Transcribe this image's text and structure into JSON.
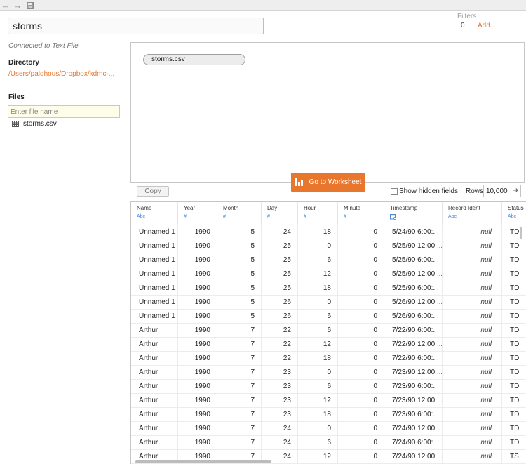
{
  "toolbar": {
    "back_icon": "back-arrow-icon",
    "forward_icon": "forward-arrow-icon",
    "save_icon": "save-icon"
  },
  "datasource": {
    "name": "storms"
  },
  "filters": {
    "title": "Filters",
    "count": "0",
    "add_label": "Add..."
  },
  "connection": {
    "status": "Connected to Text File",
    "directory_title": "Directory",
    "directory_path": "/Users/paldhous/Dropbox/kdmc-...",
    "files_title": "Files",
    "file_search_placeholder": "Enter file name",
    "files": [
      {
        "name": "storms.csv",
        "icon": "table-icon"
      }
    ]
  },
  "canvas": {
    "table_pill": "storms.csv"
  },
  "go_to_worksheet": {
    "label": "Go to Worksheet",
    "icon": "bar-chart-icon"
  },
  "grid_controls": {
    "copy_label": "Copy",
    "show_hidden_label": "Show hidden fields",
    "show_hidden_checked": false,
    "rows_label": "Rows",
    "rows_value": "10,000",
    "rows_arrow_icon": "arrow-right-icon"
  },
  "colors": {
    "accent": "#e8762c",
    "type_icon": "#4a8ad6"
  },
  "columns": [
    {
      "name": "Name",
      "type": "Abc",
      "type_icon": "string-type-icon"
    },
    {
      "name": "Year",
      "type": "#",
      "type_icon": "number-type-icon"
    },
    {
      "name": "Month",
      "type": "#",
      "type_icon": "number-type-icon"
    },
    {
      "name": "Day",
      "type": "#",
      "type_icon": "number-type-icon"
    },
    {
      "name": "Hour",
      "type": "#",
      "type_icon": "number-type-icon"
    },
    {
      "name": "Minute",
      "type": "#",
      "type_icon": "number-type-icon"
    },
    {
      "name": "Timestamp",
      "type": "",
      "type_icon": "date-time-type-icon"
    },
    {
      "name": "Record Ident",
      "type": "Abc",
      "type_icon": "string-type-icon"
    },
    {
      "name": "Status",
      "type": "Abc",
      "type_icon": "string-type-icon"
    }
  ],
  "rows": [
    [
      "Unnamed 1",
      "1990",
      "5",
      "24",
      "18",
      "0",
      "5/24/90 6:00:...",
      "null",
      "TD"
    ],
    [
      "Unnamed 1",
      "1990",
      "5",
      "25",
      "0",
      "0",
      "5/25/90 12:00:...",
      "null",
      "TD"
    ],
    [
      "Unnamed 1",
      "1990",
      "5",
      "25",
      "6",
      "0",
      "5/25/90 6:00:...",
      "null",
      "TD"
    ],
    [
      "Unnamed 1",
      "1990",
      "5",
      "25",
      "12",
      "0",
      "5/25/90 12:00:...",
      "null",
      "TD"
    ],
    [
      "Unnamed 1",
      "1990",
      "5",
      "25",
      "18",
      "0",
      "5/25/90 6:00:...",
      "null",
      "TD"
    ],
    [
      "Unnamed 1",
      "1990",
      "5",
      "26",
      "0",
      "0",
      "5/26/90 12:00:...",
      "null",
      "TD"
    ],
    [
      "Unnamed 1",
      "1990",
      "5",
      "26",
      "6",
      "0",
      "5/26/90 6:00:...",
      "null",
      "TD"
    ],
    [
      "Arthur",
      "1990",
      "7",
      "22",
      "6",
      "0",
      "7/22/90 6:00:...",
      "null",
      "TD"
    ],
    [
      "Arthur",
      "1990",
      "7",
      "22",
      "12",
      "0",
      "7/22/90 12:00:...",
      "null",
      "TD"
    ],
    [
      "Arthur",
      "1990",
      "7",
      "22",
      "18",
      "0",
      "7/22/90 6:00:...",
      "null",
      "TD"
    ],
    [
      "Arthur",
      "1990",
      "7",
      "23",
      "0",
      "0",
      "7/23/90 12:00:...",
      "null",
      "TD"
    ],
    [
      "Arthur",
      "1990",
      "7",
      "23",
      "6",
      "0",
      "7/23/90 6:00:...",
      "null",
      "TD"
    ],
    [
      "Arthur",
      "1990",
      "7",
      "23",
      "12",
      "0",
      "7/23/90 12:00:...",
      "null",
      "TD"
    ],
    [
      "Arthur",
      "1990",
      "7",
      "23",
      "18",
      "0",
      "7/23/90 6:00:...",
      "null",
      "TD"
    ],
    [
      "Arthur",
      "1990",
      "7",
      "24",
      "0",
      "0",
      "7/24/90 12:00:...",
      "null",
      "TD"
    ],
    [
      "Arthur",
      "1990",
      "7",
      "24",
      "6",
      "0",
      "7/24/90 6:00:...",
      "null",
      "TD"
    ],
    [
      "Arthur",
      "1990",
      "7",
      "24",
      "12",
      "0",
      "7/24/90 12:00:...",
      "null",
      "TS"
    ]
  ]
}
